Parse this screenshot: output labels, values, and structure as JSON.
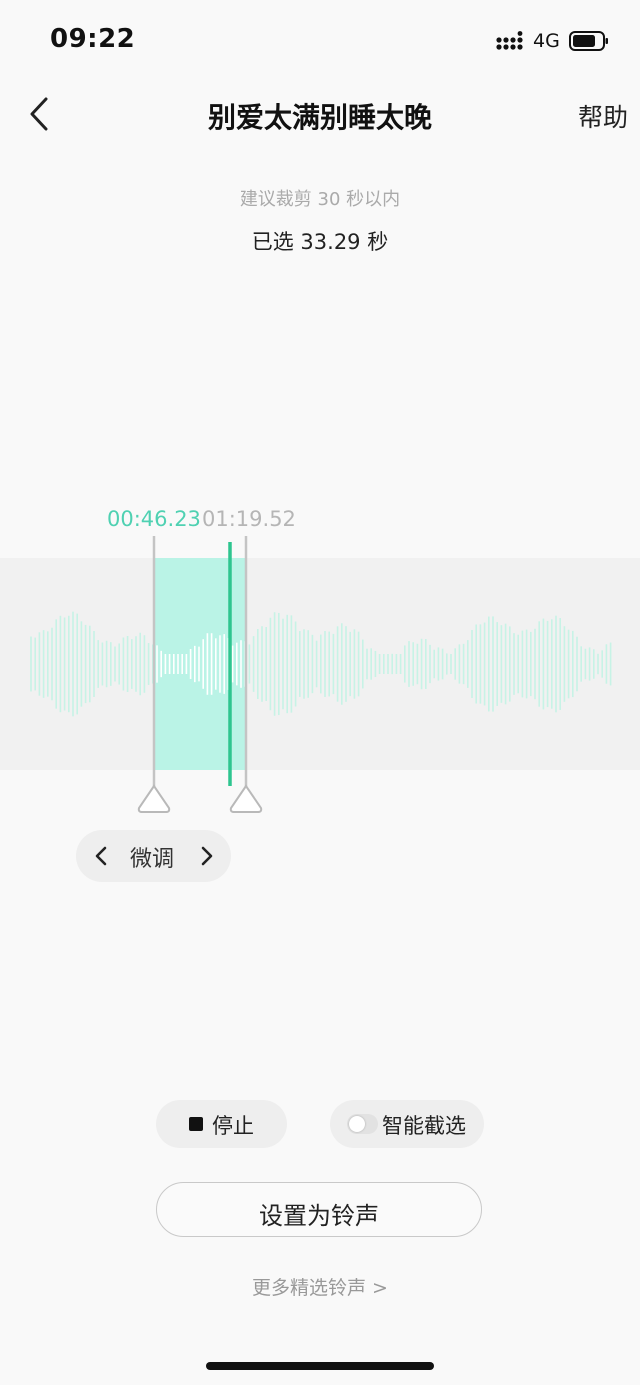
{
  "status_bar": {
    "time": "09:22",
    "network": "4G"
  },
  "header": {
    "title": "别爱太满别睡太晚",
    "help": "帮助"
  },
  "trim": {
    "hint": "建议裁剪 30 秒以内",
    "selected": "已选 33.29 秒",
    "start_time": "00:46.23",
    "end_time": "01:19.52"
  },
  "colors": {
    "accent": "#3ecfa2",
    "selection_fill": "#b8f2e6",
    "wave": "#c7f3e6"
  },
  "finetune": {
    "label": "微调"
  },
  "controls": {
    "stop_label": "停止",
    "smart_label": "智能截选",
    "smart_enabled": false
  },
  "set_button": {
    "label": "设置为铃声"
  },
  "more_link": {
    "label": "更多精选铃声 >"
  }
}
